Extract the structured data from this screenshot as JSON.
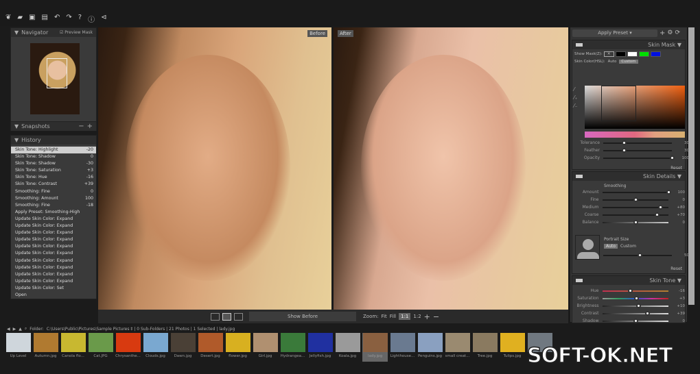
{
  "toolbar": {
    "icons": [
      "leaf-logo-icon",
      "open-icon",
      "save-icon",
      "save-as-icon",
      "undo-icon",
      "redo-icon",
      "help-icon",
      "info-icon",
      "plugin-icon"
    ]
  },
  "navigator": {
    "title": "Navigator",
    "preview_mask": "Preview Mask"
  },
  "snapshots": {
    "title": "Snapshots"
  },
  "history": {
    "title": "History",
    "items": [
      {
        "label": "Skin Tone: Highlight",
        "value": "-20"
      },
      {
        "label": "Skin Tone: Shadow",
        "value": "0"
      },
      {
        "label": "Skin Tone: Shadow",
        "value": "-30"
      },
      {
        "label": "Skin Tone: Saturation",
        "value": "+3"
      },
      {
        "label": "Skin Tone: Hue",
        "value": "-16"
      },
      {
        "label": "Skin Tone: Contrast",
        "value": "+39"
      },
      {
        "label": "Smoothing: Fine",
        "value": "0"
      },
      {
        "label": "Smoothing: Amount",
        "value": "100"
      },
      {
        "label": "Smoothing: Fine",
        "value": "-18"
      },
      {
        "label": "Apply Preset: Smoothing-High",
        "value": ""
      },
      {
        "label": "Update Skin Color: Expand",
        "value": ""
      },
      {
        "label": "Update Skin Color: Expand",
        "value": ""
      },
      {
        "label": "Update Skin Color: Expand",
        "value": ""
      },
      {
        "label": "Update Skin Color: Expand",
        "value": ""
      },
      {
        "label": "Update Skin Color: Expand",
        "value": ""
      },
      {
        "label": "Update Skin Color: Expand",
        "value": ""
      },
      {
        "label": "Update Skin Color: Expand",
        "value": ""
      },
      {
        "label": "Update Skin Color: Expand",
        "value": ""
      },
      {
        "label": "Update Skin Color: Expand",
        "value": ""
      },
      {
        "label": "Update Skin Color: Expand",
        "value": ""
      },
      {
        "label": "Update Skin Color: Set",
        "value": ""
      },
      {
        "label": "Open",
        "value": ""
      }
    ]
  },
  "viewer": {
    "before": "Before",
    "after": "After",
    "show_before": "Show Before",
    "zoom_label": "Zoom:",
    "fit": "Fit",
    "fill": "Fill",
    "one": "1:1",
    "ratio": "1:2"
  },
  "right": {
    "apply_preset": "Apply Preset",
    "skin_mask": {
      "title": "Skin Mask",
      "show_mask": "Show Mask(Z):",
      "mask_colors": [
        "#000000",
        "#ffffff",
        "#00e000",
        "#0010e0"
      ],
      "skin_color": "Skin Color(HSL):",
      "auto": "Auto",
      "custom": "Custom",
      "reset": "Reset",
      "sliders": [
        {
          "label": "Tolerance",
          "value": "30",
          "pct": 30
        },
        {
          "label": "Feather",
          "value": "30",
          "pct": 30
        },
        {
          "label": "Opacity",
          "value": "100",
          "pct": 100
        }
      ]
    },
    "skin_details": {
      "title": "Skin Details",
      "smoothing": "Smoothing",
      "portrait_size": "Portrait Size",
      "auto": "Auto",
      "custom": "Custom",
      "reset": "Reset",
      "sliders": [
        {
          "label": "Amount",
          "value": "100",
          "pct": 100
        },
        {
          "label": "Fine",
          "value": "0",
          "pct": 50
        },
        {
          "label": "Medium",
          "value": "+80",
          "pct": 88
        },
        {
          "label": "Coarse",
          "value": "+70",
          "pct": 83
        },
        {
          "label": "Balance",
          "value": "0",
          "pct": 50
        }
      ],
      "portrait_slider": {
        "value": "50",
        "pct": 53
      }
    },
    "skin_tone": {
      "title": "Skin Tone",
      "sliders": [
        {
          "label": "Hue",
          "value": "-16",
          "pct": 42
        },
        {
          "label": "Saturation",
          "value": "+3",
          "pct": 51
        },
        {
          "label": "Brightness",
          "value": "+10",
          "pct": 55
        },
        {
          "label": "Contrast",
          "value": "+39",
          "pct": 68
        },
        {
          "label": "Shadow",
          "value": "0",
          "pct": 50
        }
      ]
    }
  },
  "browser": {
    "folder_label": "Folder:",
    "path": "C:\\Users\\Public\\Pictures\\Sample Pictures ‡ | 0 Sub-Folders | 21 Photos | 1 Selected | lady.jpg",
    "thumbs": [
      {
        "name": "Up Level",
        "color": "#cfd6dc"
      },
      {
        "name": "Autumn.jpg",
        "color": "#b07a30"
      },
      {
        "name": "Canola flo...",
        "color": "#c8b830"
      },
      {
        "name": "Cat.JPG",
        "color": "#6a9a4a"
      },
      {
        "name": "Chrysanthe...",
        "color": "#d83a10"
      },
      {
        "name": "Clouds.jpg",
        "color": "#7aa8d0"
      },
      {
        "name": "Dawn.jpg",
        "color": "#4a4036"
      },
      {
        "name": "Desert.jpg",
        "color": "#b05a2a"
      },
      {
        "name": "flower.jpg",
        "color": "#d8b020"
      },
      {
        "name": "Girl.jpg",
        "color": "#b09070"
      },
      {
        "name": "Hydrangea...",
        "color": "#3a7a3a"
      },
      {
        "name": "Jellyfish.jpg",
        "color": "#2030a0"
      },
      {
        "name": "Koala.jpg",
        "color": "#9a9a9a"
      },
      {
        "name": "lady.jpg",
        "color": "#8a6040"
      },
      {
        "name": "Lighthouse...",
        "color": "#6a7a90"
      },
      {
        "name": "Penguins.jpg",
        "color": "#8aa0c0"
      },
      {
        "name": "small creat...",
        "color": "#9a8a70"
      },
      {
        "name": "Tree.jpg",
        "color": "#8a7a60"
      },
      {
        "name": "Tulips.jpg",
        "color": "#e0b020"
      },
      {
        "name": "",
        "color": "#707880"
      }
    ]
  },
  "watermark": "SOFT-OK.NET"
}
